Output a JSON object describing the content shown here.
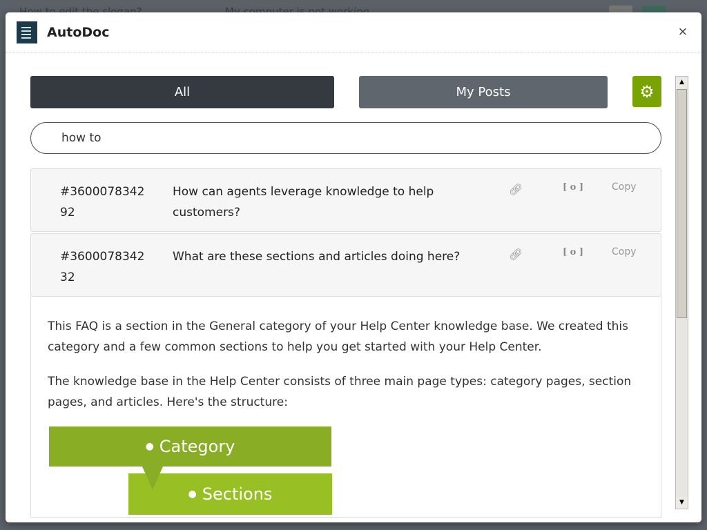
{
  "background": {
    "items": [
      "How to edit the slogan?",
      "My computer is not working"
    ]
  },
  "header": {
    "title": "AutoDoc",
    "close": "×"
  },
  "tabs": [
    {
      "label": "All",
      "active": true
    },
    {
      "label": "My Posts",
      "active": false
    }
  ],
  "settings_icon": "gear-icon",
  "search": {
    "value": "how to"
  },
  "results": [
    {
      "id": "#360007834292",
      "question": "How can agents leverage knowledge to help customers?",
      "link_icon": "link-icon",
      "embed": "[ o ]",
      "copy": "Copy"
    },
    {
      "id": "#360007834232",
      "question": "What are these sections and articles doing here?",
      "link_icon": "link-icon",
      "embed": "[ o ]",
      "copy": "Copy"
    }
  ],
  "expanded": {
    "paragraphs": [
      "This FAQ is a section in the General category of your Help Center knowledge base. We created this category and a few common sections to help you get started with your Help Center.",
      "The knowledge base in the Help Center consists of three main page types: category pages, section pages, and articles. Here's the structure:"
    ],
    "diagram": {
      "category": "Category",
      "sections": "Sections"
    }
  },
  "colors": {
    "accent": "#78a300",
    "tab_active": "#343a40",
    "tab_inactive": "#5f666d"
  }
}
